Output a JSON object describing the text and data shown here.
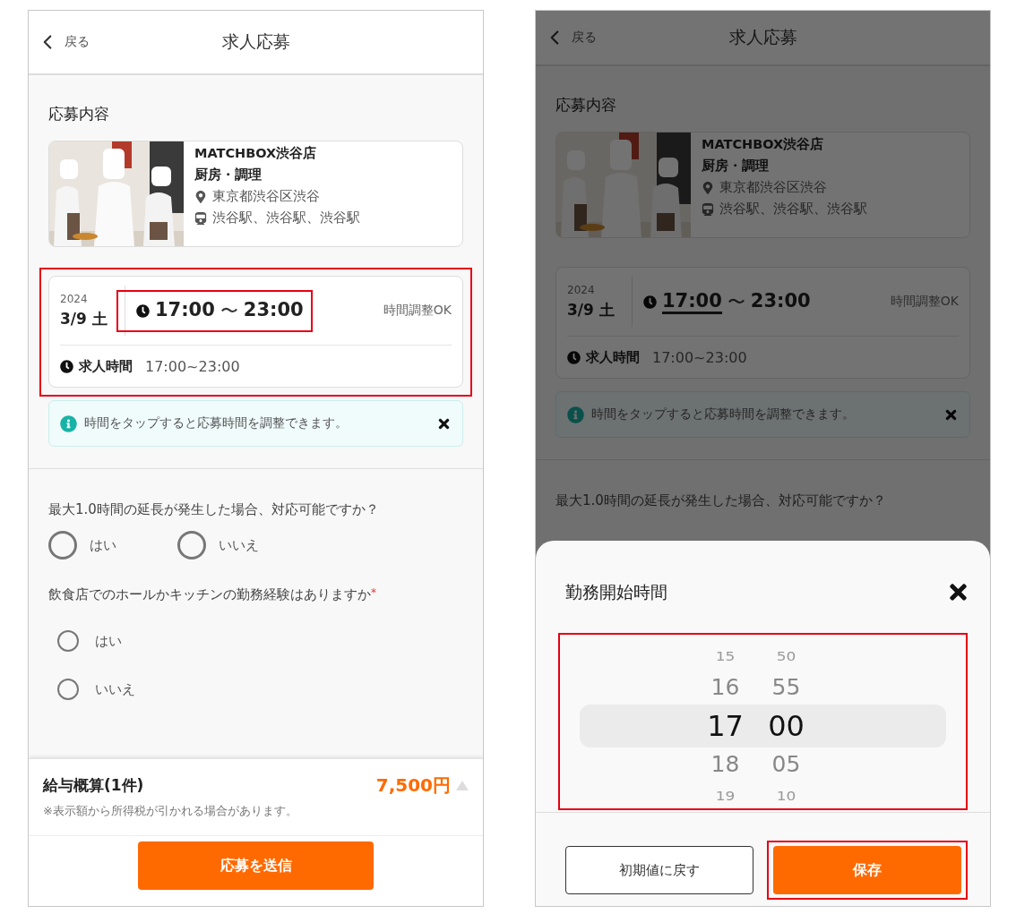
{
  "screens": [
    {
      "kind": "form",
      "header": {
        "back": "戻る",
        "title": "求人応募"
      },
      "section_title": "応募内容",
      "job": {
        "name": "MATCHBOX渋谷店",
        "role": "厨房・調理",
        "address": "東京都渋谷区渋谷",
        "stations": "渋谷駅、渋谷駅、渋谷駅"
      },
      "shift": {
        "year": "2024",
        "date": "3/9 土",
        "start": "17:00",
        "separator": "〜",
        "end": "23:00",
        "note": "時間調整OK",
        "label": "求人時間",
        "hours": "17:00~23:00",
        "highlighted": true,
        "time_highlighted": true,
        "start_underlined": false
      },
      "tip": {
        "text": "時間をタップすると応募時間を調整できます。"
      },
      "questions": [
        {
          "kind": "inline",
          "text": "最大1.0時間の延長が発生した場合、対応可能ですか？",
          "options": [
            {
              "label": "はい",
              "selected": false
            },
            {
              "label": "いいえ",
              "selected": false
            }
          ]
        },
        {
          "kind": "stacked",
          "text": "飲食店でのホールかキッチンの勤務経験はありますか",
          "required_mark": "*",
          "options": [
            {
              "label": "はい",
              "selected": false
            },
            {
              "label": "いいえ",
              "selected": false
            }
          ]
        }
      ],
      "footer": {
        "label": "給与概算(1件)",
        "amount": "7,500円",
        "expanded": false,
        "note": "※表示額から所得税が引かれる場合があります。",
        "submit": "応募を送信"
      }
    },
    {
      "kind": "sheet",
      "header": {
        "back": "戻る",
        "title": "求人応募"
      },
      "section_title": "応募内容",
      "job": {
        "name": "MATCHBOX渋谷店",
        "role": "厨房・調理",
        "address": "東京都渋谷区渋谷",
        "stations": "渋谷駅、渋谷駅、渋谷駅"
      },
      "shift": {
        "year": "2024",
        "date": "3/9 土",
        "start": "17:00",
        "separator": "〜",
        "end": "23:00",
        "note": "時間調整OK",
        "label": "求人時間",
        "hours": "17:00~23:00",
        "start_underlined": true
      },
      "tip": {
        "text": "時間をタップすると応募時間を調整できます。"
      },
      "questions": [
        {
          "kind": "inline",
          "text": "最大1.0時間の延長が発生した場合、対応可能ですか？"
        }
      ],
      "sheet": {
        "title": "勤務開始時間",
        "highlighted": true,
        "hours": [
          {
            "label": "15",
            "selected": false
          },
          {
            "label": "16",
            "selected": false
          },
          {
            "label": "17",
            "selected": true
          },
          {
            "label": "18",
            "selected": false
          },
          {
            "label": "19",
            "selected": false
          }
        ],
        "minutes": [
          {
            "label": "50",
            "selected": false
          },
          {
            "label": "55",
            "selected": false
          },
          {
            "label": "00",
            "selected": true
          },
          {
            "label": "05",
            "selected": false
          },
          {
            "label": "10",
            "selected": false
          }
        ],
        "reset": "初期値に戻す",
        "save": "保存",
        "save_highlighted": true
      }
    }
  ]
}
